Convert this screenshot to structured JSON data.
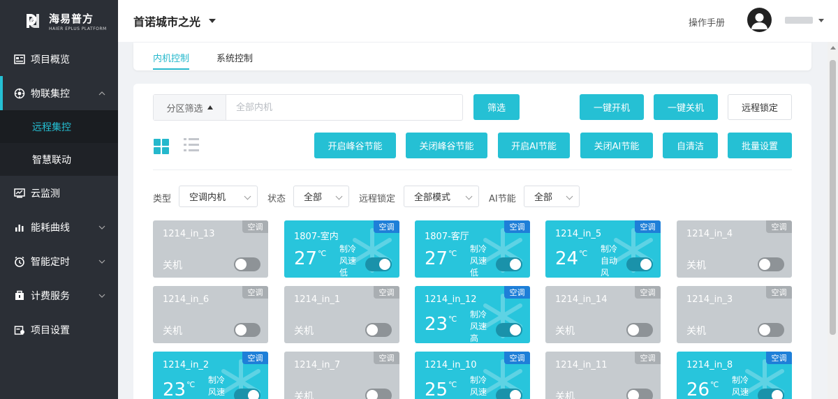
{
  "brand": {
    "title": "海易普方",
    "subtitle": "HAIER EPLUS PLATFORM"
  },
  "sidebar": {
    "items": [
      {
        "label": "项目概览",
        "icon": "overview-icon"
      },
      {
        "label": "物联集控",
        "icon": "iot-control-icon",
        "expanded": true,
        "children": [
          {
            "label": "远程集控",
            "active": true
          },
          {
            "label": "智慧联动"
          }
        ]
      },
      {
        "label": "云监测",
        "icon": "cloud-monitor-icon"
      },
      {
        "label": "能耗曲线",
        "icon": "energy-curve-icon"
      },
      {
        "label": "智能定时",
        "icon": "timer-icon"
      },
      {
        "label": "计费服务",
        "icon": "billing-icon"
      },
      {
        "label": "项目设置",
        "icon": "project-settings-icon"
      }
    ]
  },
  "header": {
    "project": "首诺城市之光",
    "manual": "操作手册"
  },
  "tabs": [
    {
      "label": "内机控制",
      "active": true
    },
    {
      "label": "系统控制"
    }
  ],
  "filter": {
    "zone_label": "分区筛选",
    "placeholder": "全部内机",
    "filter_btn": "筛选"
  },
  "actions": {
    "power_on": "一键开机",
    "power_off": "一键关机",
    "remote_lock": "远程锁定"
  },
  "batch": {
    "peak_on": "开启峰谷节能",
    "peak_off": "关闭峰谷节能",
    "ai_on": "开启AI节能",
    "ai_off": "关闭AI节能",
    "self_clean": "自清洁",
    "batch_set": "批量设置"
  },
  "selects": {
    "type": {
      "label": "类型",
      "value": "空调内机"
    },
    "status": {
      "label": "状态",
      "value": "全部"
    },
    "lock": {
      "label": "远程锁定",
      "value": "全部模式"
    },
    "ai": {
      "label": "AI节能",
      "value": "全部"
    }
  },
  "devices": [
    {
      "name": "1214_in_13",
      "tag": "空调",
      "on": false,
      "state": "关机"
    },
    {
      "name": "1807-室内",
      "tag": "空调",
      "on": true,
      "temp": "27",
      "unit": "℃",
      "mode": "制冷",
      "fan_label": "风速",
      "fan": "低"
    },
    {
      "name": "1807-客厅",
      "tag": "空调",
      "on": true,
      "temp": "27",
      "unit": "℃",
      "mode": "制冷",
      "fan_label": "风速",
      "fan": "低"
    },
    {
      "name": "1214_in_5",
      "tag": "空调",
      "on": true,
      "temp": "24",
      "unit": "℃",
      "mode": "制冷",
      "fan_label": "自动",
      "fan": "风"
    },
    {
      "name": "1214_in_4",
      "tag": "空调",
      "on": false,
      "state": "关机"
    },
    {
      "name": "1214_in_6",
      "tag": "空调",
      "on": false,
      "state": "关机"
    },
    {
      "name": "1214_in_1",
      "tag": "空调",
      "on": false,
      "state": "关机"
    },
    {
      "name": "1214_in_12",
      "tag": "空调",
      "on": true,
      "temp": "23",
      "unit": "℃",
      "mode": "制冷",
      "fan_label": "风速",
      "fan": "高"
    },
    {
      "name": "1214_in_14",
      "tag": "空调",
      "on": false,
      "state": "关机"
    },
    {
      "name": "1214_in_3",
      "tag": "空调",
      "on": false,
      "state": "关机"
    },
    {
      "name": "1214_in_2",
      "tag": "空调",
      "on": true,
      "temp": "23",
      "unit": "℃",
      "mode": "制冷",
      "fan_label": "风速",
      "fan": ""
    },
    {
      "name": "1214_in_7",
      "tag": "空调",
      "on": false,
      "state": "关机"
    },
    {
      "name": "1214_in_10",
      "tag": "空调",
      "on": true,
      "temp": "25",
      "unit": "℃",
      "mode": "制冷",
      "fan_label": "风速",
      "fan": ""
    },
    {
      "name": "1214_in_11",
      "tag": "空调",
      "on": false,
      "state": "关机"
    },
    {
      "name": "1214_in_8",
      "tag": "空调",
      "on": true,
      "temp": "26",
      "unit": "℃",
      "mode": "制冷",
      "fan_label": "风速",
      "fan": ""
    }
  ],
  "colors": {
    "accent": "#25c0d4",
    "sidebar_bg": "#2b2f36",
    "card_on": "#28c5dc",
    "card_off": "#c6cbcf",
    "tag_on": "#1e7fd8"
  }
}
